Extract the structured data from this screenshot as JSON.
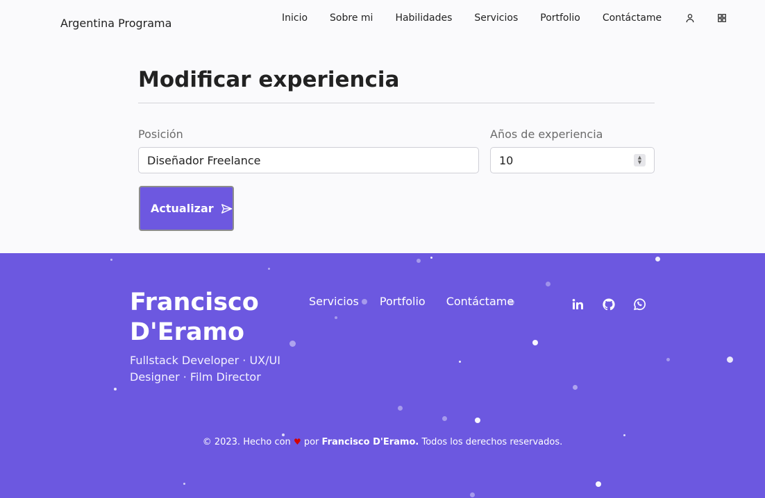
{
  "header": {
    "brand": "Argentina Programa",
    "nav": [
      "Inicio",
      "Sobre mi",
      "Habilidades",
      "Servicios",
      "Portfolio",
      "Contáctame"
    ]
  },
  "form": {
    "title": "Modificar experiencia",
    "position_label": "Posición",
    "position_value": "Diseñador Freelance",
    "years_label": "Años de experiencia",
    "years_value": "10",
    "submit_label": "Actualizar"
  },
  "footer": {
    "name_line1": "Francisco",
    "name_line2": "D'Eramo",
    "tagline": "Fullstack Developer · UX/UI Designer · Film Director",
    "links": [
      "Servicios",
      "Portfolio",
      "Contáctame"
    ],
    "social_icons": [
      "linkedin-icon",
      "github-icon",
      "whatsapp-icon"
    ],
    "copyright_prefix": "© 2023. Hecho con",
    "copyright_middle": "por",
    "copyright_author": "Francisco D'Eramo.",
    "copyright_suffix": "Todos los derechos reservados."
  },
  "colors": {
    "accent": "#6c58e0",
    "heart": "#d40000"
  }
}
